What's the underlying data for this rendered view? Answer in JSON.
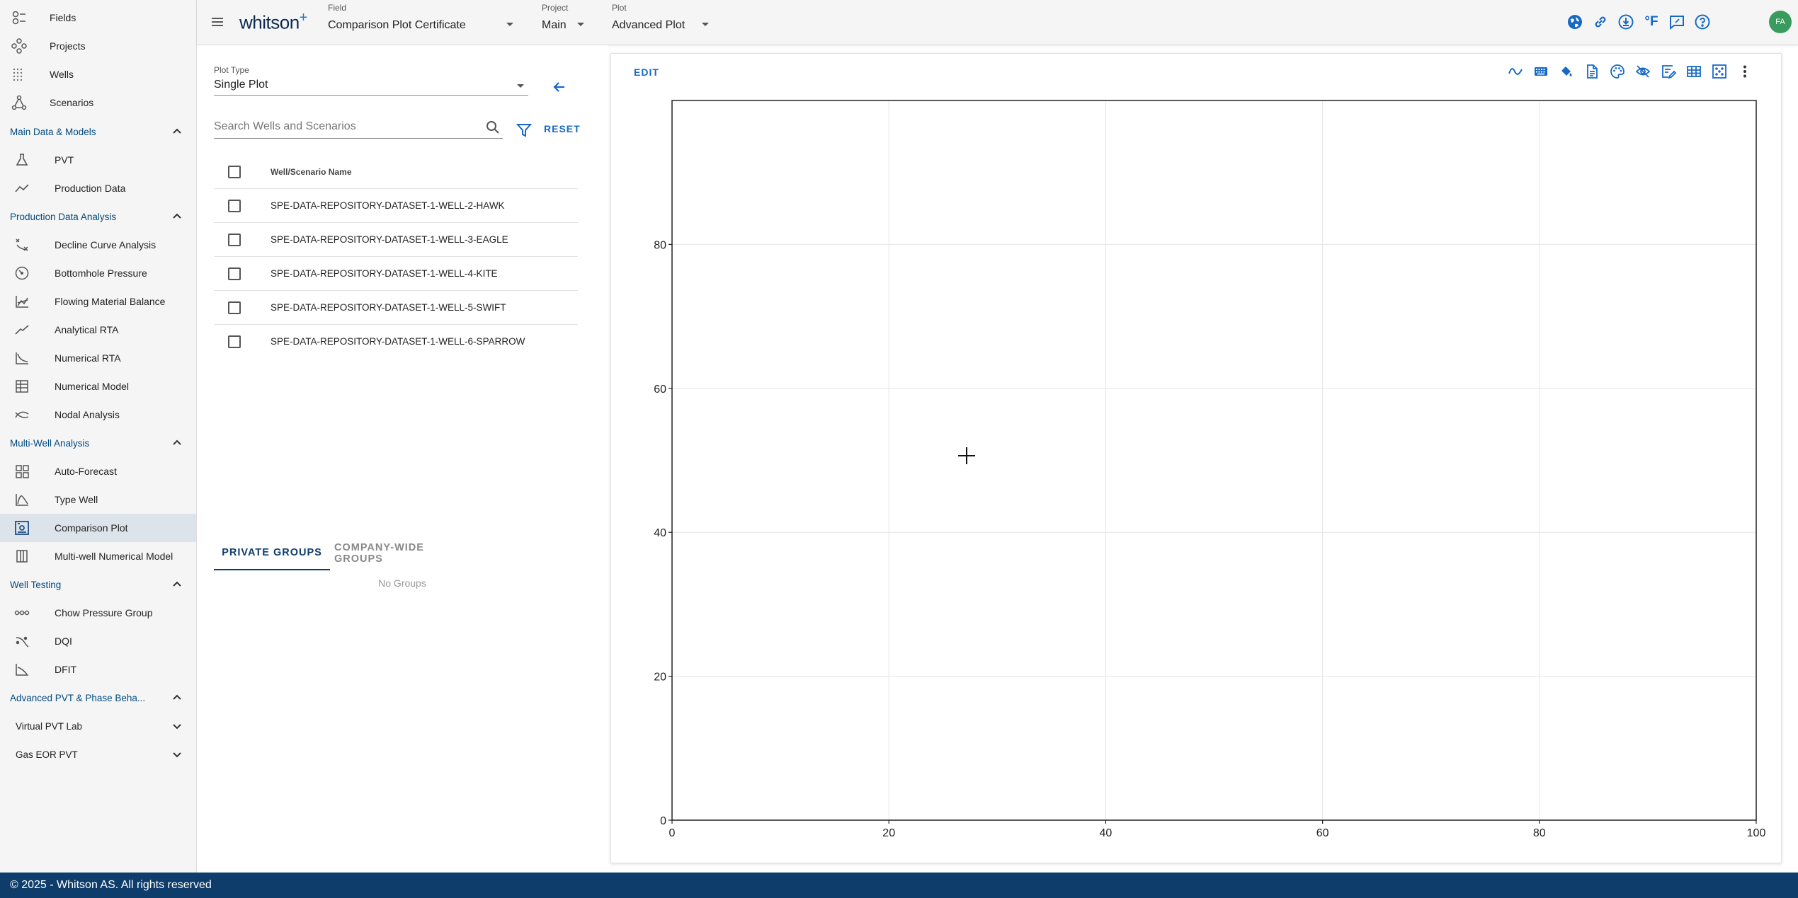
{
  "sidebar": {
    "top_items": [
      {
        "label": "Fields",
        "icon": "fields-icon"
      },
      {
        "label": "Projects",
        "icon": "projects-icon"
      },
      {
        "label": "Wells",
        "icon": "wells-icon"
      },
      {
        "label": "Scenarios",
        "icon": "scenarios-icon"
      }
    ],
    "sections": [
      {
        "title": "Main Data & Models",
        "items": [
          {
            "label": "PVT"
          },
          {
            "label": "Production Data"
          }
        ]
      },
      {
        "title": "Production Data Analysis",
        "items": [
          {
            "label": "Decline Curve Analysis"
          },
          {
            "label": "Bottomhole Pressure"
          },
          {
            "label": "Flowing Material Balance"
          },
          {
            "label": "Analytical RTA"
          },
          {
            "label": "Numerical RTA"
          },
          {
            "label": "Numerical Model"
          },
          {
            "label": "Nodal Analysis"
          }
        ]
      },
      {
        "title": "Multi-Well Analysis",
        "items": [
          {
            "label": "Auto-Forecast"
          },
          {
            "label": "Type Well"
          },
          {
            "label": "Comparison Plot"
          },
          {
            "label": "Multi-well Numerical Model"
          }
        ]
      },
      {
        "title": "Well Testing",
        "items": [
          {
            "label": "Chow Pressure Group"
          },
          {
            "label": "DQI"
          },
          {
            "label": "DFIT"
          }
        ]
      },
      {
        "title": "Advanced PVT & Phase Beha...",
        "items": [
          {
            "label": "Virtual PVT Lab"
          },
          {
            "label": "Gas EOR PVT"
          }
        ]
      }
    ]
  },
  "header": {
    "logo": "whitson",
    "logo_plus": "+",
    "field_caption": "Field",
    "field_value": "Comparison Plot Certificate",
    "project_caption": "Project",
    "project_value": "Main",
    "plot_caption": "Plot",
    "plot_value": "Advanced Plot",
    "temp_unit": "°F",
    "avatar_initials": "FA"
  },
  "left_panel": {
    "plot_type_caption": "Plot Type",
    "plot_type_value": "Single Plot",
    "search_placeholder": "Search Wells and Scenarios",
    "reset_label": "RESET",
    "table_header": "Well/Scenario Name",
    "rows": [
      "SPE-DATA-REPOSITORY-DATASET-1-WELL-2-HAWK",
      "SPE-DATA-REPOSITORY-DATASET-1-WELL-3-EAGLE",
      "SPE-DATA-REPOSITORY-DATASET-1-WELL-4-KITE",
      "SPE-DATA-REPOSITORY-DATASET-1-WELL-5-SWIFT",
      "SPE-DATA-REPOSITORY-DATASET-1-WELL-6-SPARROW"
    ],
    "tabs": [
      "PRIVATE GROUPS",
      "COMPANY-WIDE GROUPS"
    ],
    "no_groups": "No Groups"
  },
  "plot_card": {
    "edit_label": "EDIT"
  },
  "chart_data": {
    "type": "scatter",
    "series": [],
    "x_ticks": [
      0,
      20,
      40,
      60,
      80,
      100
    ],
    "y_ticks": [
      0,
      20,
      40,
      60,
      80
    ],
    "xlim": [
      0,
      100
    ],
    "ylim": [
      0,
      100
    ],
    "grid": true
  },
  "footer": {
    "text": "© 2025 - Whitson AS. All rights reserved"
  },
  "colors": {
    "accent": "#1769c8",
    "navy": "#0e3c6b",
    "section": "#004a80",
    "avatar": "#3a9b5e"
  }
}
